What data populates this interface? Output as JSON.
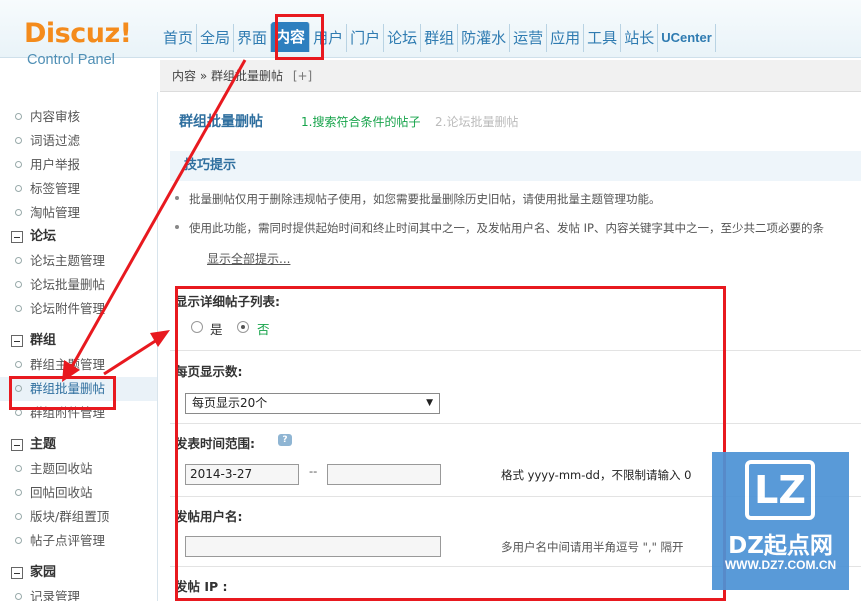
{
  "logo": {
    "brand": "Discuz!",
    "subtitle": "Control Panel"
  },
  "topnav": [
    {
      "label": "首页"
    },
    {
      "label": "全局"
    },
    {
      "label": "界面"
    },
    {
      "label": "内容",
      "active": true
    },
    {
      "label": "用户"
    },
    {
      "label": "门户"
    },
    {
      "label": "论坛"
    },
    {
      "label": "群组"
    },
    {
      "label": "防灌水"
    },
    {
      "label": "运营"
    },
    {
      "label": "应用"
    },
    {
      "label": "工具"
    },
    {
      "label": "站长"
    },
    {
      "label": "UCenter"
    }
  ],
  "breadcrumb": {
    "text": "内容 » 群组批量删帖",
    "plus": "[+]"
  },
  "sidebar": {
    "content_items": [
      "内容审核",
      "词语过滤",
      "用户举报",
      "标签管理",
      "淘帖管理"
    ],
    "forum": {
      "title": "论坛",
      "items": [
        "论坛主题管理",
        "论坛批量删帖",
        "论坛附件管理"
      ]
    },
    "group": {
      "title": "群组",
      "items": [
        "群组主题管理",
        "群组批量删帖",
        "群组附件管理"
      ]
    },
    "thread": {
      "title": "主题",
      "items": [
        "主题回收站",
        "回帖回收站",
        "版块/群组置顶",
        "帖子点评管理"
      ]
    },
    "home": {
      "title": "家园",
      "items": [
        "记录管理"
      ]
    }
  },
  "main": {
    "title": "群组批量删帖",
    "step1": "1.搜索符合条件的帖子",
    "step2": "2.论坛批量删帖",
    "tips_title": "技巧提示",
    "tips": [
      "批量删帖仅用于删除违规帖子使用，如您需要批量删除历史旧帖，请使用批量主题管理功能。",
      "使用此功能，需同时提供起始时间和终止时间其中之一，及发帖用户名、发帖 IP、内容关键字其中之一，至少共二项必要的条"
    ],
    "tips_more": "显示全部提示..."
  },
  "form": {
    "detail_list_label": "显示详细帖子列表:",
    "radio_yes": "是",
    "radio_no": "否",
    "per_page_label": "每页显示数:",
    "per_page_value": "每页显示20个",
    "date_range_label": "发表时间范围:",
    "date_start": "2014-3-27",
    "date_sep": "--",
    "date_end": "",
    "date_help": "格式 yyyy-mm-dd，不限制请输入 0",
    "author_label": "发帖用户名:",
    "author_value": "",
    "author_help": "多用户名中间请用半角逗号 \",\" 隔开",
    "ip_label": "发帖 IP :"
  },
  "watermark": {
    "logo": "LZ",
    "name": "DZ起点网",
    "url": "WWW.DZ7.COM.CN"
  },
  "colors": {
    "annotation_red": "#e8191f",
    "nav_blue": "#2d7fbf",
    "link_green": "#16a34a"
  }
}
